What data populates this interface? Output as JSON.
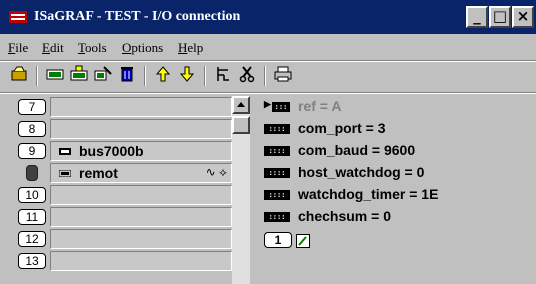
{
  "window": {
    "title": "ISaGRAF - TEST - I/O connection",
    "buttons": [
      "_",
      "□",
      "×"
    ]
  },
  "menu": [
    "File",
    "Edit",
    "Tools",
    "Options",
    "Help"
  ],
  "toolbar": [
    "open-icon",
    "board-icon",
    "board-add-icon",
    "board-connect-icon",
    "delete-icon",
    "arrow-up-icon",
    "arrow-down-icon",
    "tree-icon",
    "cut-icon",
    "print-icon"
  ],
  "slots": [
    {
      "num": "7",
      "label": ""
    },
    {
      "num": "8",
      "label": ""
    },
    {
      "num": "9",
      "label": "bus7000b",
      "icon": "board-icon"
    },
    {
      "num": "",
      "label": "remot",
      "icon": "board-icon",
      "tail": "∿ ⟡",
      "locked": true
    },
    {
      "num": "10",
      "label": ""
    },
    {
      "num": "11",
      "label": ""
    },
    {
      "num": "12",
      "label": ""
    },
    {
      "num": "13",
      "label": ""
    }
  ],
  "params": [
    {
      "text": "ref = A",
      "icon": "ref-icon",
      "dim": true
    },
    {
      "text": "com_port = 3",
      "icon": "param-icon"
    },
    {
      "text": "com_baud = 9600",
      "icon": "param-icon"
    },
    {
      "text": "host_watchdog = 0",
      "icon": "param-icon"
    },
    {
      "text": "watchdog_timer = 1E",
      "icon": "param-icon"
    },
    {
      "text": "chechsum = 0",
      "icon": "param-icon"
    }
  ],
  "channel": {
    "num": "1"
  }
}
